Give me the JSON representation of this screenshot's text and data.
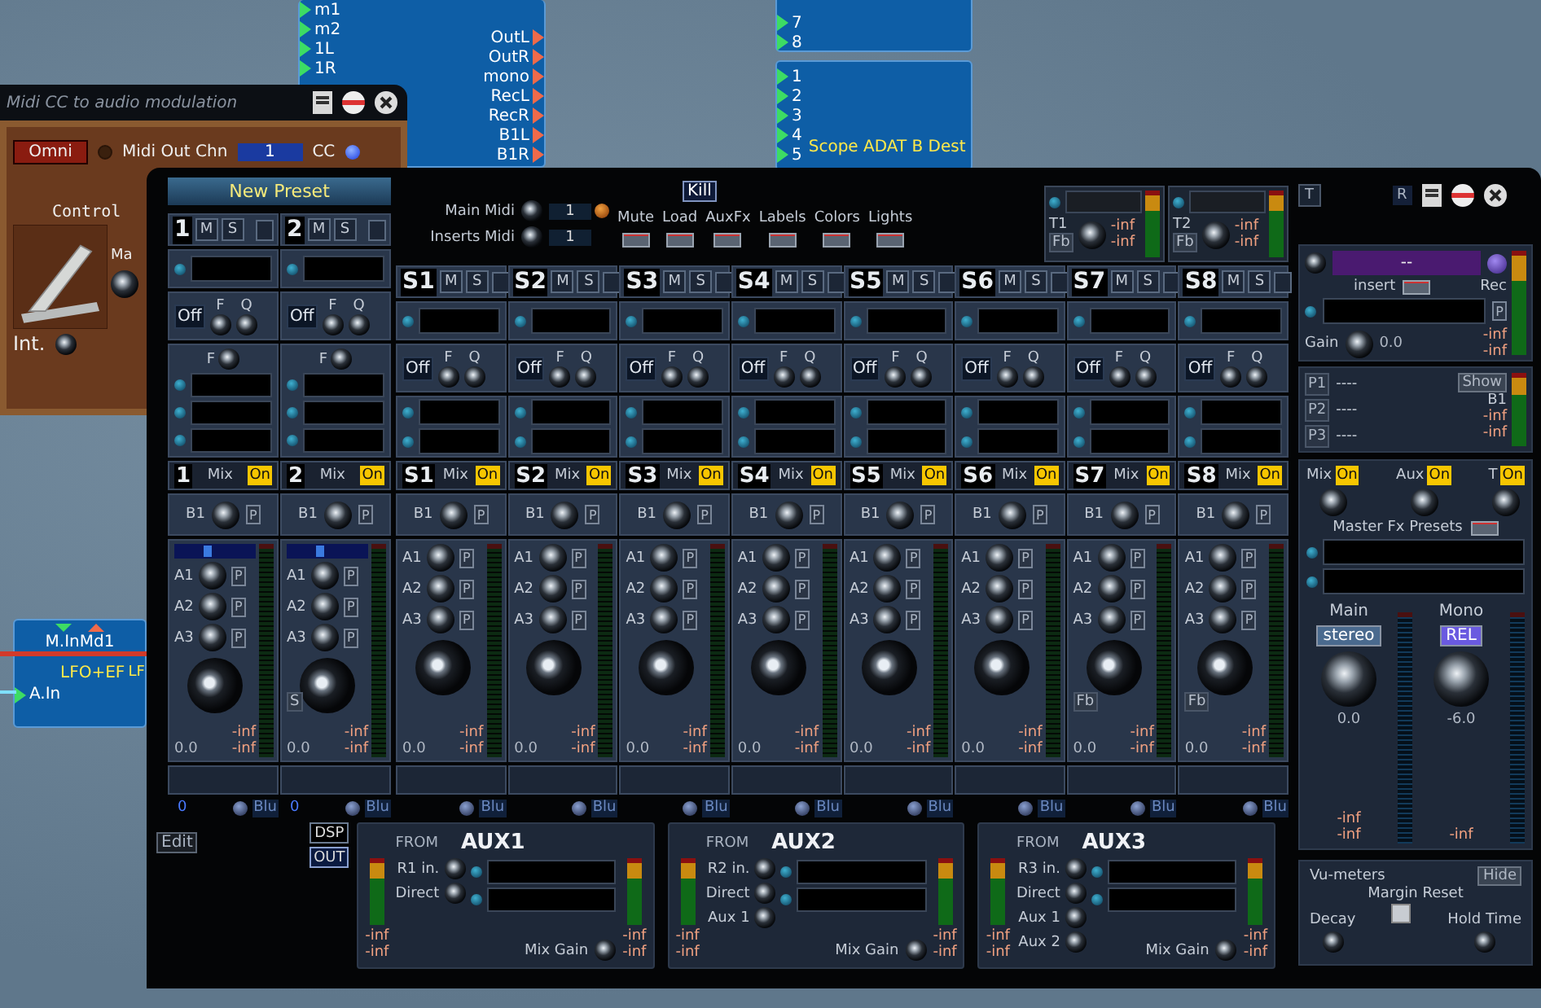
{
  "desktop": {
    "modules": [
      {
        "inputs": [
          "m1",
          "m2",
          "1L",
          "1R"
        ],
        "outputs": [
          "OutL",
          "OutR",
          "mono",
          "RecL",
          "RecR",
          "B1L",
          "B1R"
        ]
      },
      {
        "inputs": [
          "7",
          "8"
        ]
      },
      {
        "title": "Scope ADAT B Dest",
        "inputs": [
          "1",
          "2",
          "3",
          "4",
          "5"
        ]
      }
    ],
    "lfo": {
      "title": "M.InMd1",
      "name": "LFO+EF",
      "input": "A.In",
      "cut_label": "LF"
    }
  },
  "midi_window": {
    "title": "Midi CC to audio modulation",
    "channel": "Omni",
    "out_label": "Midi Out Chn",
    "out_value": "1",
    "cc": "CC",
    "control": "Control",
    "cut_label": "Ma",
    "int": "Int."
  },
  "mixer": {
    "preset": "New Preset",
    "midi": [
      {
        "label": "Main Midi",
        "value": "1"
      },
      {
        "label": "Inserts Midi",
        "value": "1"
      }
    ],
    "kill": "Kill",
    "toggles": [
      "Mute",
      "Load",
      "AuxFx",
      "Labels",
      "Colors",
      "Lights"
    ],
    "returns": [
      {
        "name": "T1",
        "tag": "Fb",
        "readings": [
          "-inf",
          "-inf"
        ]
      },
      {
        "name": "T2",
        "tag": "Fb",
        "readings": [
          "-inf",
          "-inf"
        ]
      }
    ],
    "corner_buttons": [
      "T",
      "R"
    ],
    "inputs": [
      {
        "name": "1",
        "mute": "M",
        "solo": "S",
        "eq": "Off",
        "f": "F",
        "q": "Q",
        "hp": "F",
        "mix_name": "1",
        "mix": "Mix",
        "on": "On",
        "bus": "B1",
        "bus_p": "P",
        "sends": [
          {
            "name": "A1",
            "p": "P"
          },
          {
            "name": "A2",
            "p": "P"
          },
          {
            "name": "A3",
            "p": "P"
          }
        ],
        "gain": "0.0",
        "readings": [
          "-inf",
          "-inf"
        ],
        "number": "0",
        "color_label": "Blu"
      },
      {
        "name": "2",
        "mute": "M",
        "solo": "S",
        "eq": "Off",
        "f": "F",
        "q": "Q",
        "hp": "F",
        "mix_name": "2",
        "mix": "Mix",
        "on": "On",
        "bus": "B1",
        "bus_p": "P",
        "sends": [
          {
            "name": "A1",
            "p": "P"
          },
          {
            "name": "A2",
            "p": "P"
          },
          {
            "name": "A3",
            "p": "P"
          }
        ],
        "tag": "S",
        "gain": "0.0",
        "readings": [
          "-inf",
          "-inf"
        ],
        "number": "0",
        "color_label": "Blu"
      }
    ],
    "subgroups": [
      {
        "name": "S1",
        "mute": "M",
        "solo": "S",
        "eq": "Off",
        "f": "F",
        "q": "Q",
        "mix_name": "S1",
        "mix": "Mix",
        "on": "On",
        "bus": "B1",
        "bus_p": "P",
        "sends": [
          {
            "name": "A1",
            "p": "P"
          },
          {
            "name": "A2",
            "p": "P"
          },
          {
            "name": "A3",
            "p": "P"
          }
        ],
        "gain": "0.0",
        "readings": [
          "-inf",
          "-inf"
        ],
        "color_label": "Blu"
      },
      {
        "name": "S2",
        "mute": "M",
        "solo": "S",
        "eq": "Off",
        "f": "F",
        "q": "Q",
        "mix_name": "S2",
        "mix": "Mix",
        "on": "On",
        "bus": "B1",
        "bus_p": "P",
        "sends": [
          {
            "name": "A1",
            "p": "P"
          },
          {
            "name": "A2",
            "p": "P"
          },
          {
            "name": "A3",
            "p": "P"
          }
        ],
        "gain": "0.0",
        "readings": [
          "-inf",
          "-inf"
        ],
        "color_label": "Blu"
      },
      {
        "name": "S3",
        "mute": "M",
        "solo": "S",
        "eq": "Off",
        "f": "F",
        "q": "Q",
        "mix_name": "S3",
        "mix": "Mix",
        "on": "On",
        "bus": "B1",
        "bus_p": "P",
        "sends": [
          {
            "name": "A1",
            "p": "P"
          },
          {
            "name": "A2",
            "p": "P"
          },
          {
            "name": "A3",
            "p": "P"
          }
        ],
        "gain": "0.0",
        "readings": [
          "-inf",
          "-inf"
        ],
        "color_label": "Blu"
      },
      {
        "name": "S4",
        "mute": "M",
        "solo": "S",
        "eq": "Off",
        "f": "F",
        "q": "Q",
        "mix_name": "S4",
        "mix": "Mix",
        "on": "On",
        "bus": "B1",
        "bus_p": "P",
        "sends": [
          {
            "name": "A1",
            "p": "P"
          },
          {
            "name": "A2",
            "p": "P"
          },
          {
            "name": "A3",
            "p": "P"
          }
        ],
        "gain": "0.0",
        "readings": [
          "-inf",
          "-inf"
        ],
        "color_label": "Blu"
      },
      {
        "name": "S5",
        "mute": "M",
        "solo": "S",
        "eq": "Off",
        "f": "F",
        "q": "Q",
        "mix_name": "S5",
        "mix": "Mix",
        "on": "On",
        "bus": "B1",
        "bus_p": "P",
        "sends": [
          {
            "name": "A1",
            "p": "P"
          },
          {
            "name": "A2",
            "p": "P"
          },
          {
            "name": "A3",
            "p": "P"
          }
        ],
        "gain": "0.0",
        "readings": [
          "-inf",
          "-inf"
        ],
        "color_label": "Blu"
      },
      {
        "name": "S6",
        "mute": "M",
        "solo": "S",
        "eq": "Off",
        "f": "F",
        "q": "Q",
        "mix_name": "S6",
        "mix": "Mix",
        "on": "On",
        "bus": "B1",
        "bus_p": "P",
        "sends": [
          {
            "name": "A1",
            "p": "P"
          },
          {
            "name": "A2",
            "p": "P"
          },
          {
            "name": "A3",
            "p": "P"
          }
        ],
        "gain": "0.0",
        "readings": [
          "-inf",
          "-inf"
        ],
        "color_label": "Blu"
      },
      {
        "name": "S7",
        "mute": "M",
        "solo": "S",
        "eq": "Off",
        "f": "F",
        "q": "Q",
        "mix_name": "S7",
        "mix": "Mix",
        "on": "On",
        "bus": "B1",
        "bus_p": "P",
        "sends": [
          {
            "name": "A1",
            "p": "P"
          },
          {
            "name": "A2",
            "p": "P"
          },
          {
            "name": "A3",
            "p": "P"
          }
        ],
        "tag": "Fb",
        "gain": "0.0",
        "readings": [
          "-inf",
          "-inf"
        ],
        "color_label": "Blu"
      },
      {
        "name": "S8",
        "mute": "M",
        "solo": "S",
        "eq": "Off",
        "f": "F",
        "q": "Q",
        "mix_name": "S8",
        "mix": "Mix",
        "on": "On",
        "bus": "B1",
        "bus_p": "P",
        "sends": [
          {
            "name": "A1",
            "p": "P"
          },
          {
            "name": "A2",
            "p": "P"
          },
          {
            "name": "A3",
            "p": "P"
          }
        ],
        "tag": "Fb",
        "gain": "0.0",
        "readings": [
          "-inf",
          "-inf"
        ],
        "color_label": "Blu"
      }
    ],
    "edit": "Edit",
    "dsp": "DSP",
    "out": "OUT",
    "aux": [
      {
        "name": "AUX1",
        "from": "FROM",
        "sources": [
          "R1 in.",
          "Direct"
        ],
        "mix_gain": "Mix Gain",
        "left_readings": [
          "-inf",
          "-inf"
        ],
        "right_readings": [
          "-inf",
          "-inf"
        ]
      },
      {
        "name": "AUX2",
        "from": "FROM",
        "sources": [
          "R2 in.",
          "Direct",
          "Aux 1"
        ],
        "mix_gain": "Mix Gain",
        "left_readings": [
          "-inf",
          "-inf"
        ],
        "right_readings": [
          "-inf",
          "-inf"
        ]
      },
      {
        "name": "AUX3",
        "from": "FROM",
        "sources": [
          "R3 in.",
          "Direct",
          "Aux 1",
          "Aux 2"
        ],
        "mix_gain": "Mix Gain",
        "left_readings": [
          "-inf",
          "-inf"
        ],
        "right_readings": [
          "-inf",
          "-inf"
        ]
      }
    ],
    "master": {
      "insert_display": "--",
      "insert": "insert",
      "rec": "Rec",
      "p": "P",
      "gain": "Gain",
      "gain_value": "0.0",
      "readings": [
        "-inf",
        "-inf"
      ],
      "presets": [
        {
          "slot": "P1",
          "value": "----"
        },
        {
          "slot": "P2",
          "value": "----"
        },
        {
          "slot": "P3",
          "value": "----"
        }
      ],
      "show": "Show",
      "bus": "B1",
      "bus_readings": [
        "-inf",
        "-inf"
      ],
      "sends": [
        {
          "label": "Mix",
          "on": "On"
        },
        {
          "label": "Aux",
          "on": "On"
        },
        {
          "label": "T",
          "on": "On"
        }
      ],
      "fx_presets": "Master Fx Presets",
      "outputs": [
        {
          "label": "Main",
          "mode": "stereo",
          "value": "0.0",
          "readings": [
            "-inf",
            "-inf"
          ]
        },
        {
          "label": "Mono",
          "mode": "REL",
          "value": "-6.0",
          "readings": [
            "-inf"
          ]
        }
      ]
    },
    "vu": {
      "title": "Vu-meters",
      "hide": "Hide",
      "reset": "Margin Reset",
      "decay": "Decay",
      "hold": "Hold Time"
    }
  }
}
